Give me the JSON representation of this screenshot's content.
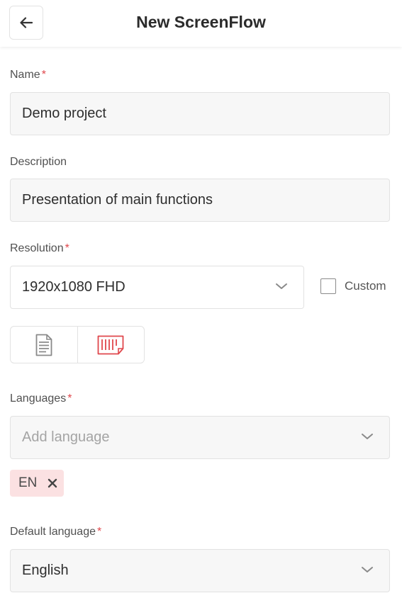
{
  "header": {
    "title": "New ScreenFlow",
    "back_icon": "arrow-left-icon"
  },
  "form": {
    "name": {
      "label": "Name",
      "required_mark": "*",
      "value": "Demo project"
    },
    "description": {
      "label": "Description",
      "value": "Presentation of main functions"
    },
    "resolution": {
      "label": "Resolution",
      "required_mark": "*",
      "selected": "1920x1080 FHD",
      "custom_label": "Custom",
      "custom_checked": false,
      "orientation_options": [
        {
          "icon": "portrait-document-icon",
          "selected": false
        },
        {
          "icon": "landscape-document-icon",
          "selected": true
        }
      ]
    },
    "languages": {
      "label": "Languages",
      "required_mark": "*",
      "placeholder": "Add language",
      "tags": [
        {
          "code": "EN",
          "remove_icon": "close-icon"
        }
      ]
    },
    "default_language": {
      "label": "Default language",
      "required_mark": "*",
      "selected": "English"
    }
  },
  "colors": {
    "accent": "#e0474c",
    "tag_background": "#fbe1e2",
    "field_background": "#f7f7f7",
    "border": "#e2e2e2"
  }
}
